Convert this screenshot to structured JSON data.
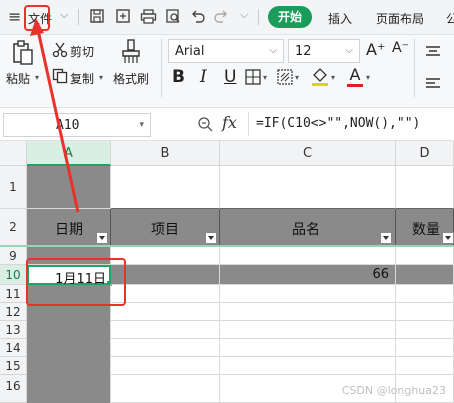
{
  "menubar": {
    "hamburger_icon": "≡",
    "file_label": "文件",
    "tabs": [
      "开始",
      "插入",
      "页面布局",
      "公"
    ]
  },
  "ribbon": {
    "paste_label": "粘贴",
    "cut_label": "剪切",
    "copy_label": "复制",
    "format_painter_label": "格式刷",
    "font_name": "Arial",
    "font_size": "12",
    "bold": "B",
    "italic": "I",
    "underline": "U",
    "font_color_letter": "A",
    "grow_font": "A⁺",
    "shrink_font": "A⁻"
  },
  "formula_bar": {
    "name_box": "A10",
    "fx": "fx",
    "formula": "=IF(C10<>\"\",NOW(),\"\")"
  },
  "grid": {
    "columns": [
      "A",
      "B",
      "C",
      "D"
    ],
    "rows": [
      "1",
      "2",
      "9",
      "10",
      "11",
      "12",
      "13",
      "14",
      "15",
      "16"
    ],
    "headers": {
      "a": "日期",
      "b": "项目",
      "c": "品名",
      "d": "数量"
    },
    "row10": {
      "a": "1月11日",
      "c": "66"
    }
  },
  "watermark": "CSDN @longhua23",
  "colors": {
    "accent_green": "#1a9c5b",
    "selection_green": "#21a366",
    "annotation_red": "#e8322b",
    "header_fill": "#8a8a8a"
  }
}
